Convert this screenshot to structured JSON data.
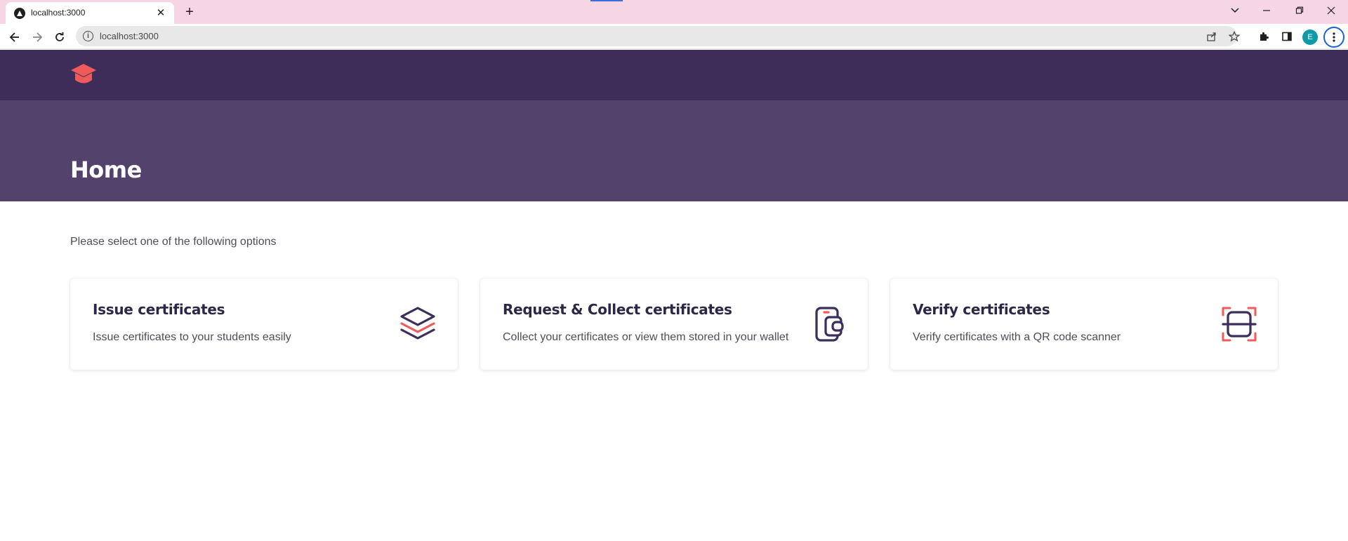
{
  "browser": {
    "tab_title": "localhost:3000",
    "tab_close_glyph": "✕",
    "new_tab_glyph": "+",
    "url": "localhost:3000",
    "profile_initial": "E",
    "icons": [
      "chevron-down-icon",
      "minimize-icon",
      "restore-icon",
      "close-icon",
      "back-icon",
      "forward-icon",
      "reload-icon",
      "info-icon",
      "share-icon",
      "star-icon",
      "extensions-icon",
      "side-panel-icon",
      "menu-icon"
    ]
  },
  "app": {
    "header_bg": "#3f2d59",
    "hero_bg": "#53436c",
    "accent": "#ef5a5a",
    "logo_icon": "graduation-cap-icon"
  },
  "hero": {
    "title": "Home"
  },
  "main": {
    "intro": "Please select one of the following options",
    "cards": [
      {
        "title": "Issue certificates",
        "description": "Issue certificates to your students easily",
        "icon": "layers-icon"
      },
      {
        "title": "Request & Collect certificates",
        "description": "Collect your certificates or view them stored in your wallet",
        "icon": "wallet-icon"
      },
      {
        "title": "Verify certificates",
        "description": "Verify certificates with a QR code scanner",
        "icon": "scan-icon"
      }
    ]
  }
}
